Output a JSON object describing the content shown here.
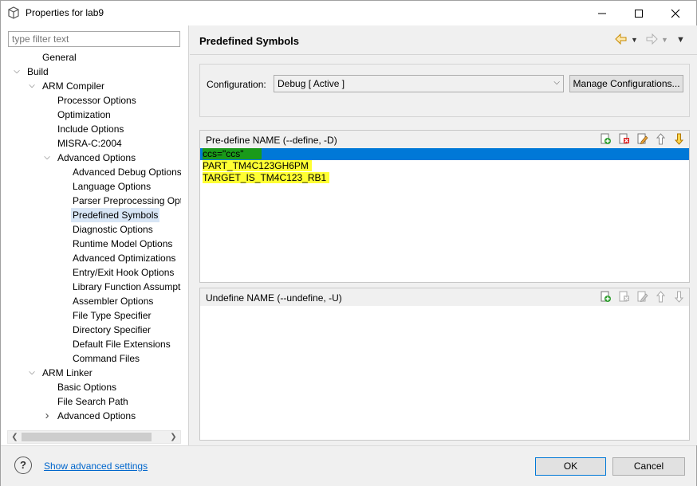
{
  "window": {
    "title": "Properties for lab9",
    "app_icon": "properties-icon",
    "controls": {
      "minimize": "—",
      "maximize": "☐",
      "close": "✕"
    }
  },
  "sidebar": {
    "filter_placeholder": "type filter text",
    "tree": [
      {
        "label": "General",
        "level": 1,
        "twisty": ""
      },
      {
        "label": "Build",
        "level": 0,
        "twisty": "expanded"
      },
      {
        "label": "ARM Compiler",
        "level": 1,
        "twisty": "expanded"
      },
      {
        "label": "Processor Options",
        "level": 2,
        "twisty": ""
      },
      {
        "label": "Optimization",
        "level": 2,
        "twisty": ""
      },
      {
        "label": "Include Options",
        "level": 2,
        "twisty": ""
      },
      {
        "label": "MISRA-C:2004",
        "level": 2,
        "twisty": ""
      },
      {
        "label": "Advanced Options",
        "level": 2,
        "twisty": "expanded"
      },
      {
        "label": "Advanced Debug Options",
        "level": 3,
        "twisty": ""
      },
      {
        "label": "Language Options",
        "level": 3,
        "twisty": ""
      },
      {
        "label": "Parser Preprocessing Opti",
        "level": 3,
        "twisty": ""
      },
      {
        "label": "Predefined Symbols",
        "level": 3,
        "twisty": "",
        "selected": true
      },
      {
        "label": "Diagnostic Options",
        "level": 3,
        "twisty": ""
      },
      {
        "label": "Runtime Model Options",
        "level": 3,
        "twisty": ""
      },
      {
        "label": "Advanced Optimizations",
        "level": 3,
        "twisty": ""
      },
      {
        "label": "Entry/Exit Hook Options",
        "level": 3,
        "twisty": ""
      },
      {
        "label": "Library Function Assumpt",
        "level": 3,
        "twisty": ""
      },
      {
        "label": "Assembler Options",
        "level": 3,
        "twisty": ""
      },
      {
        "label": "File Type Specifier",
        "level": 3,
        "twisty": ""
      },
      {
        "label": "Directory Specifier",
        "level": 3,
        "twisty": ""
      },
      {
        "label": "Default File Extensions",
        "level": 3,
        "twisty": ""
      },
      {
        "label": "Command Files",
        "level": 3,
        "twisty": ""
      },
      {
        "label": "ARM Linker",
        "level": 1,
        "twisty": "expanded"
      },
      {
        "label": "Basic Options",
        "level": 2,
        "twisty": ""
      },
      {
        "label": "File Search Path",
        "level": 2,
        "twisty": ""
      },
      {
        "label": "Advanced Options",
        "level": 2,
        "twisty": "collapsed"
      }
    ]
  },
  "main": {
    "title": "Predefined Symbols",
    "configuration": {
      "label": "Configuration:",
      "value": "Debug  [ Active ]",
      "manage_label": "Manage Configurations..."
    },
    "predefine": {
      "header": "Pre-define NAME (--define, -D)",
      "items": [
        "ccs=\"ccs\"",
        "PART_TM4C123GH6PM",
        "TARGET_IS_TM4C123_RB1"
      ],
      "selected_index": 0
    },
    "undefine": {
      "header": "Undefine NAME (--undefine, -U)",
      "items": []
    }
  },
  "footer": {
    "help_symbol": "?",
    "advanced_link": "Show advanced settings",
    "ok_label": "OK",
    "cancel_label": "Cancel"
  },
  "colors": {
    "selection_blue": "#0078d7",
    "highlight_yellow": "#ffff33",
    "highlight_green": "#1a9a1a",
    "tree_selection": "#d8e6f6",
    "link_blue": "#0066cc"
  }
}
